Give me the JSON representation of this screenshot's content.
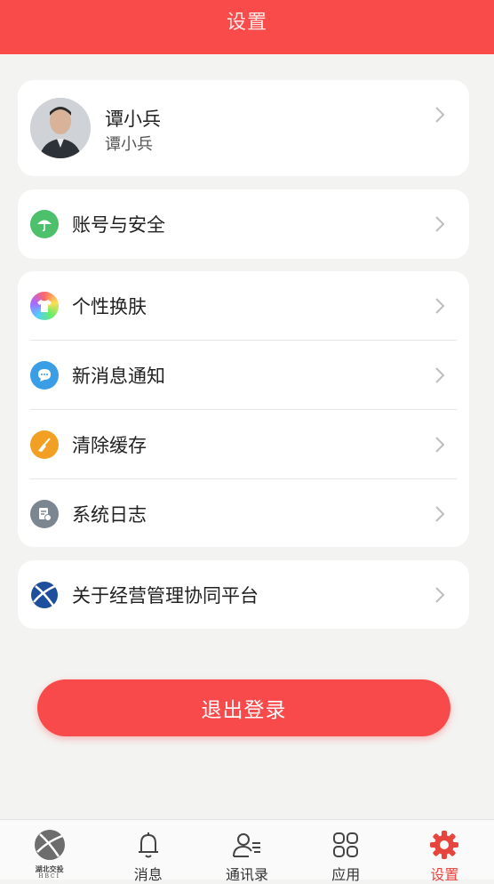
{
  "header": {
    "title": "设置"
  },
  "profile": {
    "name": "谭小兵",
    "subtitle": "谭小兵",
    "avatar_icon": "user-photo"
  },
  "account": {
    "label": "账号与安全",
    "icon": "umbrella-icon",
    "icon_color": "#4cc06a"
  },
  "settings_items": [
    {
      "label": "个性换肤",
      "icon": "shirt-icon"
    },
    {
      "label": "新消息通知",
      "icon": "chat-bubble-icon",
      "icon_color": "#3a9ee6"
    },
    {
      "label": "清除缓存",
      "icon": "broom-icon",
      "icon_color": "#f2a024"
    },
    {
      "label": "系统日志",
      "icon": "log-icon",
      "icon_color": "#7b8690"
    }
  ],
  "about": {
    "label": "关于经营管理协同平台",
    "icon": "platform-logo-icon"
  },
  "logout": {
    "label": "退出登录",
    "color": "#f84a4a"
  },
  "tabbar": {
    "logo_text": "湖北交投",
    "logo_sub": "HBCI",
    "tabs": [
      {
        "label": "消息",
        "icon": "bell-icon"
      },
      {
        "label": "通讯录",
        "icon": "contacts-icon"
      },
      {
        "label": "应用",
        "icon": "apps-grid-icon"
      },
      {
        "label": "设置",
        "icon": "gear-icon",
        "active": true
      }
    ]
  },
  "colors": {
    "accent": "#fa4b4b",
    "background": "#f3f3f1"
  }
}
